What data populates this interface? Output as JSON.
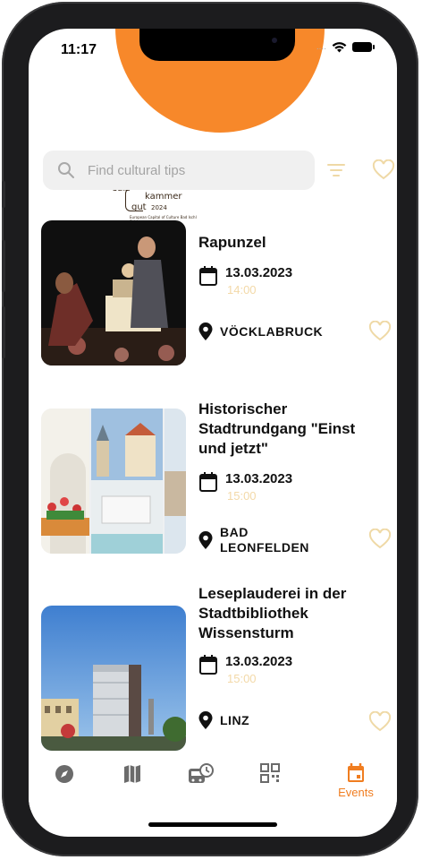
{
  "status_bar": {
    "time": "11:17",
    "signal": "...."
  },
  "logo": {
    "line1": "salz",
    "line2": "kammer",
    "line3": "gut",
    "year": "2024",
    "subtitle": "European Capital of Culture Bad Ischl Salzkammergut"
  },
  "search": {
    "placeholder": "Find cultural tips"
  },
  "icons": {
    "search": "search-icon",
    "filter": "filter-icon",
    "favorite": "heart-outline-icon",
    "calendar": "calendar-icon",
    "location": "location-pin-icon"
  },
  "colors": {
    "accent": "#f7882a",
    "time_text": "#f3d9a8",
    "heart": "#efd9a6",
    "nav_inactive": "#6b6b6b"
  },
  "events": [
    {
      "title": "Rapunzel",
      "date": "13.03.2023",
      "time": "14:00",
      "location": "VÖCKLABRUCK"
    },
    {
      "title": "Historischer Stadtrundgang \"Einst und jetzt\"",
      "date": "13.03.2023",
      "time": "15:00",
      "location": "BAD LEONFELDEN"
    },
    {
      "title": "Leseplauderei in der Stadtbibliothek Wissensturm",
      "date": "13.03.2023",
      "time": "15:00",
      "location": "LINZ"
    }
  ],
  "tabbar": {
    "tabs": [
      {
        "name": "explore",
        "icon": "compass-icon",
        "label": ""
      },
      {
        "name": "map",
        "icon": "map-icon",
        "label": ""
      },
      {
        "name": "transport",
        "icon": "bus-clock-icon",
        "label": ""
      },
      {
        "name": "qr",
        "icon": "qr-code-icon",
        "label": ""
      },
      {
        "name": "events",
        "icon": "calendar-icon",
        "label": "Events",
        "active": true
      }
    ]
  }
}
